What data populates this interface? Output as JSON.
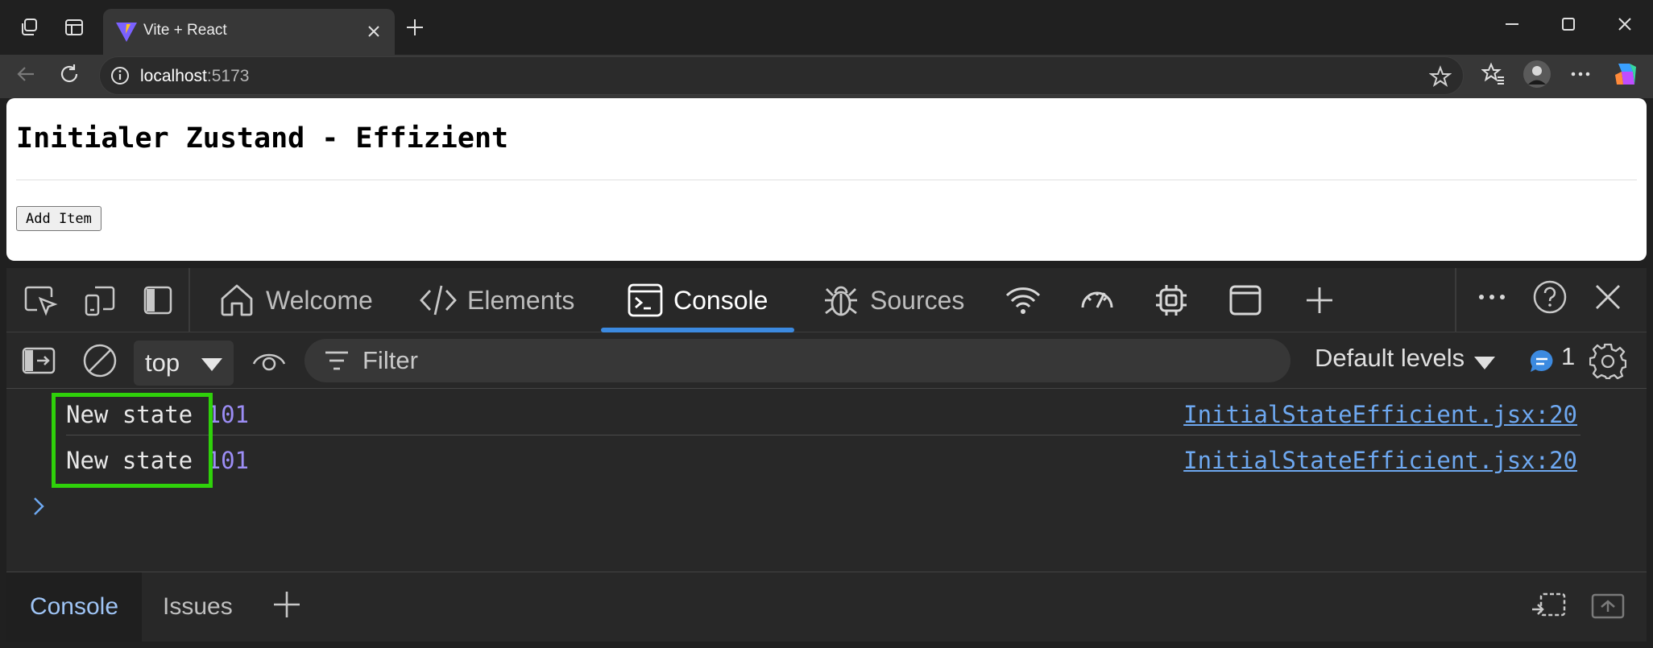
{
  "browser": {
    "tab_title": "Vite + React",
    "url_host": "localhost",
    "url_port": ":5173"
  },
  "page": {
    "heading": "Initialer Zustand - Effizient",
    "button_label": "Add Item"
  },
  "devtools": {
    "tabs": [
      {
        "label": "Welcome"
      },
      {
        "label": "Elements"
      },
      {
        "label": "Console"
      },
      {
        "label": "Sources"
      }
    ],
    "active_tab": "Console",
    "context": "top",
    "filter_placeholder": "Filter",
    "levels": "Default levels",
    "message_count": "1",
    "logs": [
      {
        "text": "New state ",
        "value": "101",
        "source": "InitialStateEfficient.jsx:20"
      },
      {
        "text": "New state ",
        "value": "101",
        "source": "InitialStateEfficient.jsx:20"
      }
    ],
    "drawer_tabs": [
      {
        "label": "Console"
      },
      {
        "label": "Issues"
      }
    ]
  },
  "colors": {
    "highlight": "#2fd10a",
    "accent": "#3c8ae0",
    "log_number": "#9c8df5",
    "link": "#6ea8f0"
  }
}
